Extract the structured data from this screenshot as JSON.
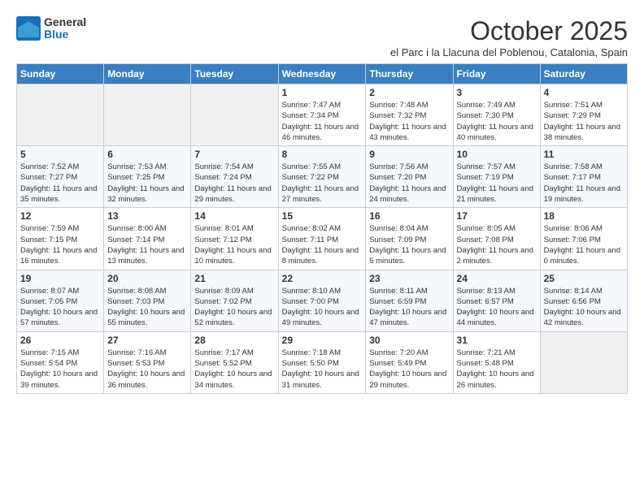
{
  "header": {
    "logo_general": "General",
    "logo_blue": "Blue",
    "title": "October 2025",
    "subtitle": "el Parc i la Llacuna del Poblenou, Catalonia, Spain"
  },
  "weekdays": [
    "Sunday",
    "Monday",
    "Tuesday",
    "Wednesday",
    "Thursday",
    "Friday",
    "Saturday"
  ],
  "weeks": [
    [
      {
        "day": "",
        "info": ""
      },
      {
        "day": "",
        "info": ""
      },
      {
        "day": "",
        "info": ""
      },
      {
        "day": "1",
        "info": "Sunrise: 7:47 AM\nSunset: 7:34 PM\nDaylight: 11 hours and 46 minutes."
      },
      {
        "day": "2",
        "info": "Sunrise: 7:48 AM\nSunset: 7:32 PM\nDaylight: 11 hours and 43 minutes."
      },
      {
        "day": "3",
        "info": "Sunrise: 7:49 AM\nSunset: 7:30 PM\nDaylight: 11 hours and 40 minutes."
      },
      {
        "day": "4",
        "info": "Sunrise: 7:51 AM\nSunset: 7:29 PM\nDaylight: 11 hours and 38 minutes."
      }
    ],
    [
      {
        "day": "5",
        "info": "Sunrise: 7:52 AM\nSunset: 7:27 PM\nDaylight: 11 hours and 35 minutes."
      },
      {
        "day": "6",
        "info": "Sunrise: 7:53 AM\nSunset: 7:25 PM\nDaylight: 11 hours and 32 minutes."
      },
      {
        "day": "7",
        "info": "Sunrise: 7:54 AM\nSunset: 7:24 PM\nDaylight: 11 hours and 29 minutes."
      },
      {
        "day": "8",
        "info": "Sunrise: 7:55 AM\nSunset: 7:22 PM\nDaylight: 11 hours and 27 minutes."
      },
      {
        "day": "9",
        "info": "Sunrise: 7:56 AM\nSunset: 7:20 PM\nDaylight: 11 hours and 24 minutes."
      },
      {
        "day": "10",
        "info": "Sunrise: 7:57 AM\nSunset: 7:19 PM\nDaylight: 11 hours and 21 minutes."
      },
      {
        "day": "11",
        "info": "Sunrise: 7:58 AM\nSunset: 7:17 PM\nDaylight: 11 hours and 19 minutes."
      }
    ],
    [
      {
        "day": "12",
        "info": "Sunrise: 7:59 AM\nSunset: 7:15 PM\nDaylight: 11 hours and 16 minutes."
      },
      {
        "day": "13",
        "info": "Sunrise: 8:00 AM\nSunset: 7:14 PM\nDaylight: 11 hours and 13 minutes."
      },
      {
        "day": "14",
        "info": "Sunrise: 8:01 AM\nSunset: 7:12 PM\nDaylight: 11 hours and 10 minutes."
      },
      {
        "day": "15",
        "info": "Sunrise: 8:02 AM\nSunset: 7:11 PM\nDaylight: 11 hours and 8 minutes."
      },
      {
        "day": "16",
        "info": "Sunrise: 8:04 AM\nSunset: 7:09 PM\nDaylight: 11 hours and 5 minutes."
      },
      {
        "day": "17",
        "info": "Sunrise: 8:05 AM\nSunset: 7:08 PM\nDaylight: 11 hours and 2 minutes."
      },
      {
        "day": "18",
        "info": "Sunrise: 8:06 AM\nSunset: 7:06 PM\nDaylight: 11 hours and 0 minutes."
      }
    ],
    [
      {
        "day": "19",
        "info": "Sunrise: 8:07 AM\nSunset: 7:05 PM\nDaylight: 10 hours and 57 minutes."
      },
      {
        "day": "20",
        "info": "Sunrise: 8:08 AM\nSunset: 7:03 PM\nDaylight: 10 hours and 55 minutes."
      },
      {
        "day": "21",
        "info": "Sunrise: 8:09 AM\nSunset: 7:02 PM\nDaylight: 10 hours and 52 minutes."
      },
      {
        "day": "22",
        "info": "Sunrise: 8:10 AM\nSunset: 7:00 PM\nDaylight: 10 hours and 49 minutes."
      },
      {
        "day": "23",
        "info": "Sunrise: 8:11 AM\nSunset: 6:59 PM\nDaylight: 10 hours and 47 minutes."
      },
      {
        "day": "24",
        "info": "Sunrise: 8:13 AM\nSunset: 6:57 PM\nDaylight: 10 hours and 44 minutes."
      },
      {
        "day": "25",
        "info": "Sunrise: 8:14 AM\nSunset: 6:56 PM\nDaylight: 10 hours and 42 minutes."
      }
    ],
    [
      {
        "day": "26",
        "info": "Sunrise: 7:15 AM\nSunset: 5:54 PM\nDaylight: 10 hours and 39 minutes."
      },
      {
        "day": "27",
        "info": "Sunrise: 7:16 AM\nSunset: 5:53 PM\nDaylight: 10 hours and 36 minutes."
      },
      {
        "day": "28",
        "info": "Sunrise: 7:17 AM\nSunset: 5:52 PM\nDaylight: 10 hours and 34 minutes."
      },
      {
        "day": "29",
        "info": "Sunrise: 7:18 AM\nSunset: 5:50 PM\nDaylight: 10 hours and 31 minutes."
      },
      {
        "day": "30",
        "info": "Sunrise: 7:20 AM\nSunset: 5:49 PM\nDaylight: 10 hours and 29 minutes."
      },
      {
        "day": "31",
        "info": "Sunrise: 7:21 AM\nSunset: 5:48 PM\nDaylight: 10 hours and 26 minutes."
      },
      {
        "day": "",
        "info": ""
      }
    ]
  ]
}
